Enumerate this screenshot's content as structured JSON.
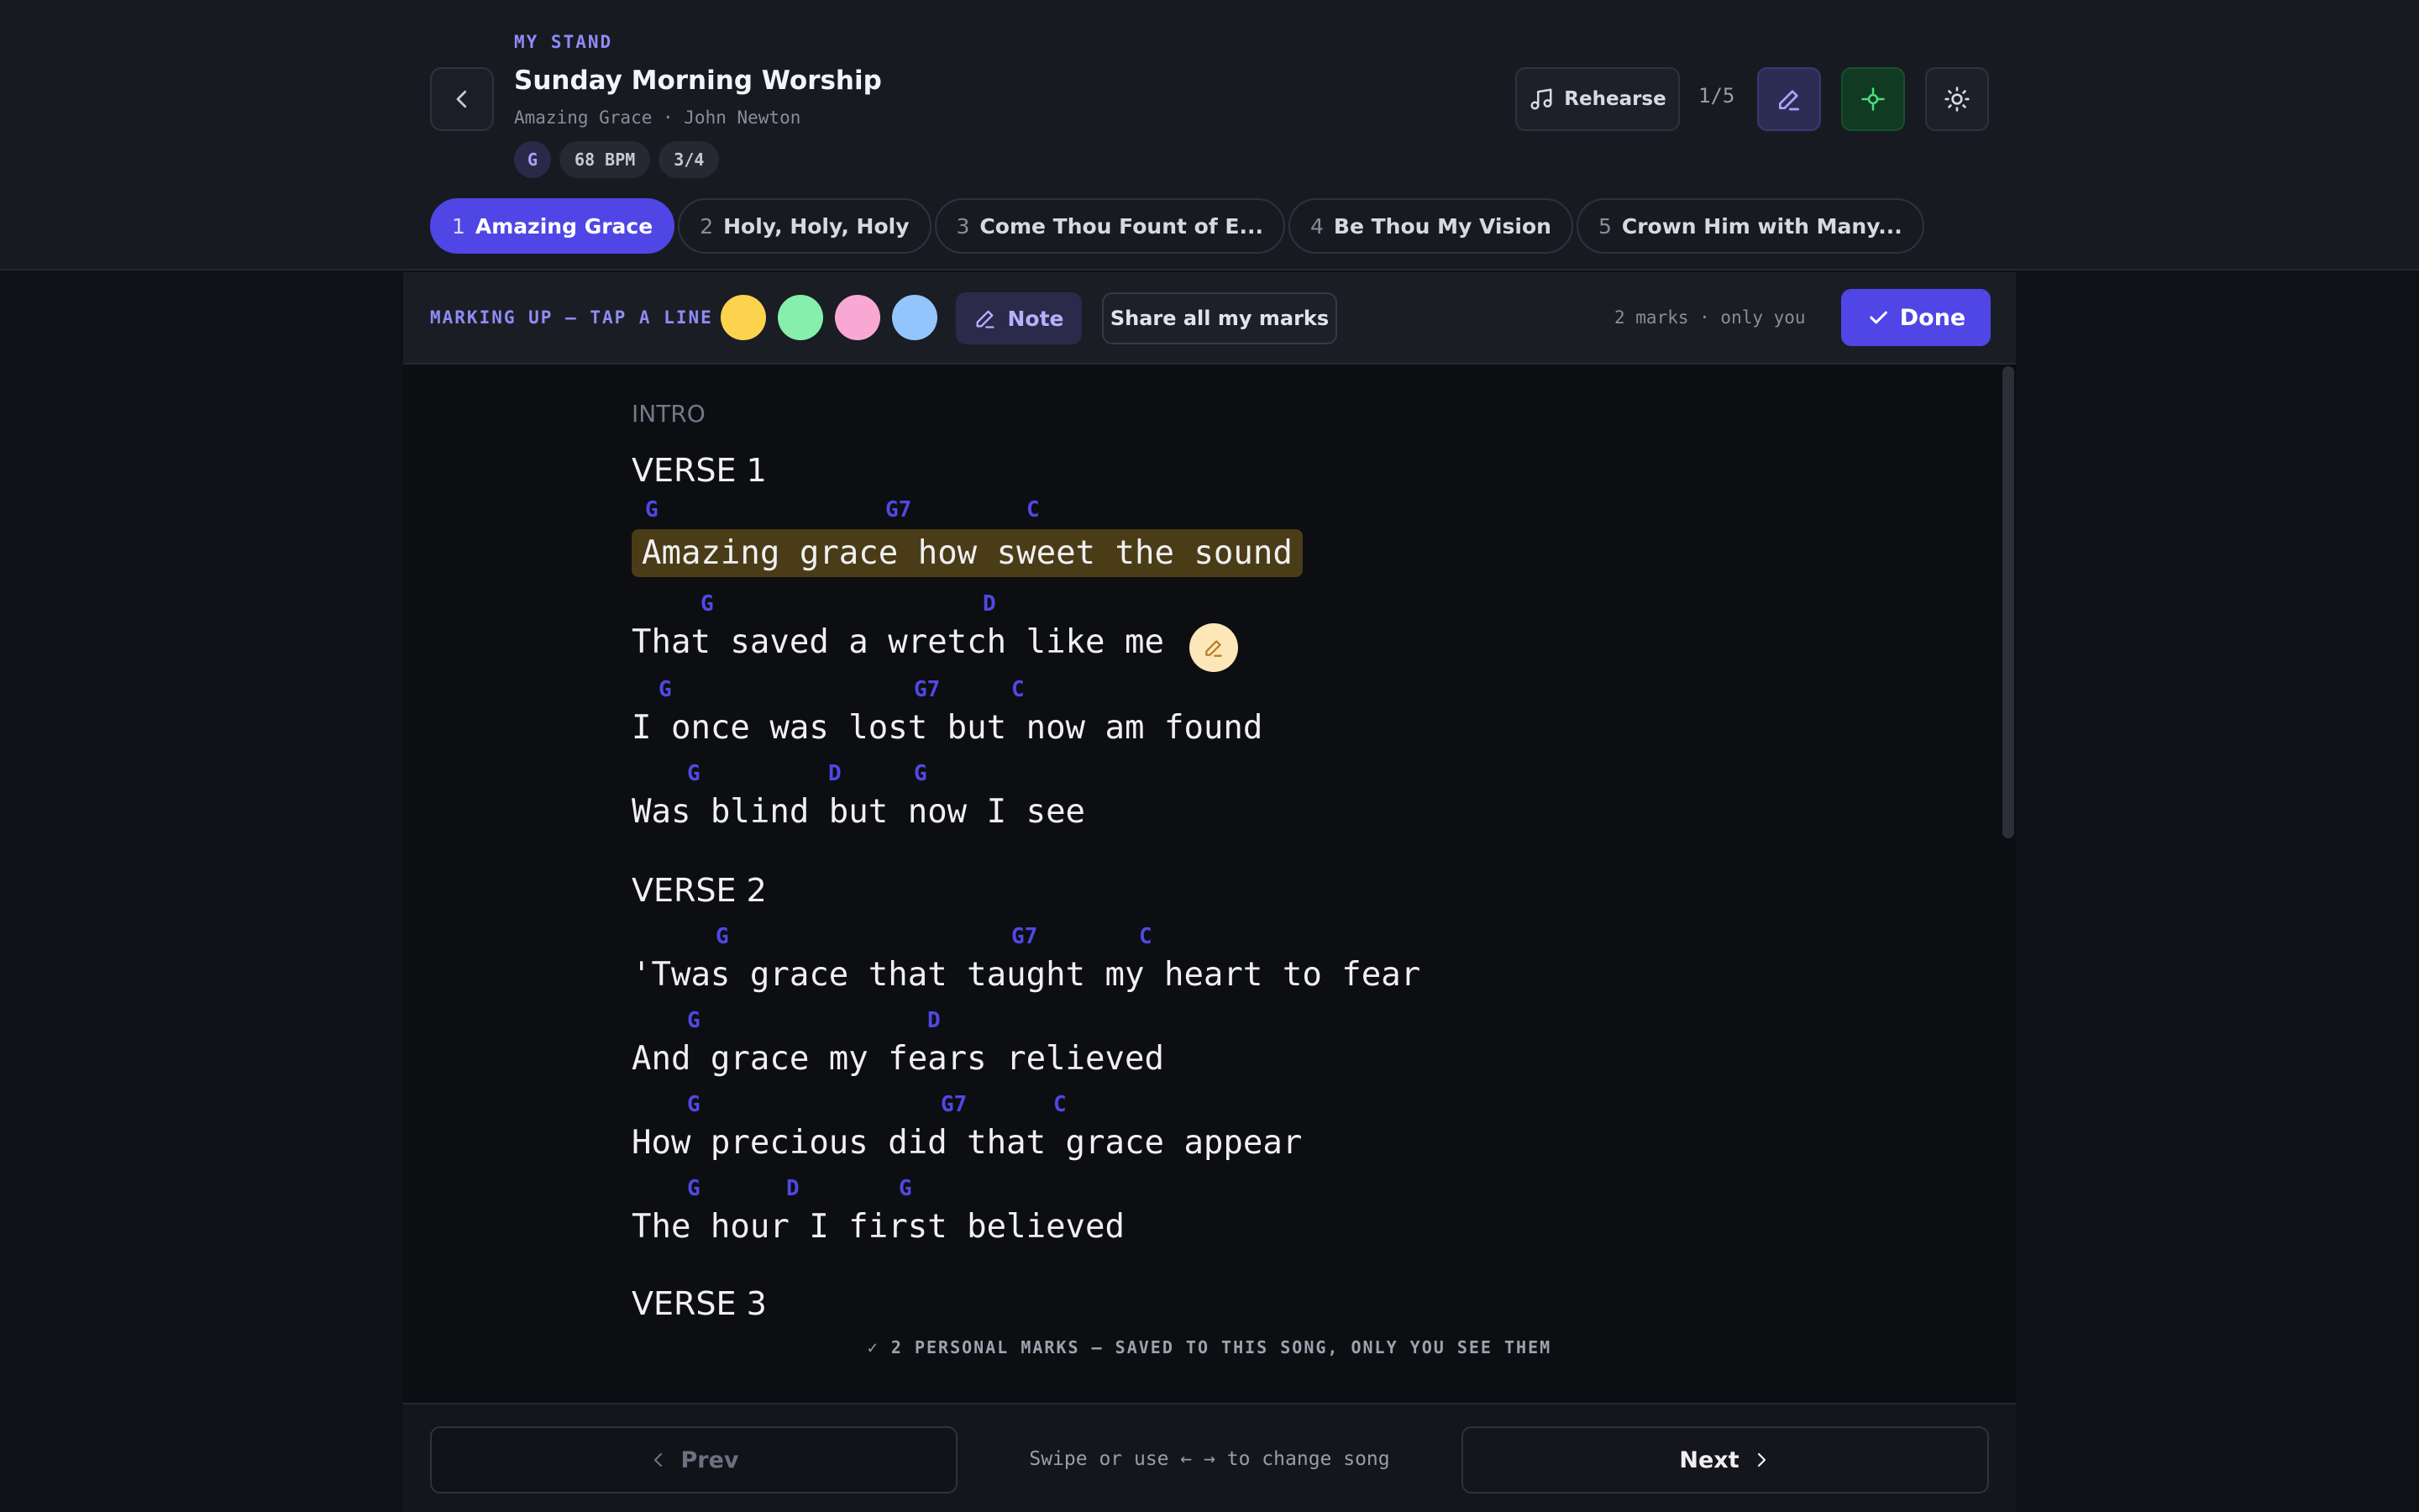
{
  "header": {
    "eyebrow": "MY STAND",
    "title": "Sunday Morning Worship",
    "song_meta": "Amazing Grace · John Newton",
    "chips": {
      "key": "G",
      "bpm": "68 BPM",
      "time": "3/4"
    },
    "rehearse_label": "Rehearse",
    "position": "1/5",
    "icons": {
      "back": "chevron-left-icon",
      "rehearse": "music-note-icon",
      "edit": "pencil-icon",
      "focus": "crosshair-icon",
      "theme": "sun-icon"
    }
  },
  "tabs": [
    {
      "num": "1",
      "label": "Amazing Grace",
      "active": true
    },
    {
      "num": "2",
      "label": "Holy, Holy, Holy"
    },
    {
      "num": "3",
      "label": "Come Thou Fount of E..."
    },
    {
      "num": "4",
      "label": "Be Thou My Vision"
    },
    {
      "num": "5",
      "label": "Crown Him with Many..."
    }
  ],
  "markup": {
    "label": "MARKING UP — TAP A LINE",
    "colors": [
      "#fcd34d",
      "#86efac",
      "#f9a8d4",
      "#93c5fd"
    ],
    "note_label": "Note",
    "share_label": "Share all my marks",
    "marks_count": "2 marks · only you",
    "done_label": "Done",
    "highlight_color": "#4a3c16"
  },
  "song": {
    "intro": "INTRO",
    "verse1": {
      "heading": "VERSE 1",
      "lines": [
        {
          "chords": [
            "G",
            "G7",
            "C"
          ],
          "text": "Amazing grace how sweet the sound"
        },
        {
          "chords": [
            "G",
            "D"
          ],
          "text": "That saved a wretch like me"
        },
        {
          "chords": [
            "G",
            "G7",
            "C"
          ],
          "text": "I once was lost but now am found"
        },
        {
          "chords": [
            "G",
            "D",
            "G"
          ],
          "text": "Was blind but now I see"
        }
      ]
    },
    "verse2": {
      "heading": "VERSE 2",
      "lines": [
        {
          "chords": [
            "G",
            "G7",
            "C"
          ],
          "text": "'Twas grace that taught my heart to fear"
        },
        {
          "chords": [
            "G",
            "D"
          ],
          "text": "And grace my fears relieved"
        },
        {
          "chords": [
            "G",
            "G7",
            "C"
          ],
          "text": "How precious did that grace appear"
        },
        {
          "chords": [
            "G",
            "D",
            "G"
          ],
          "text": "The hour I first believed"
        }
      ]
    },
    "verse3": {
      "heading": "VERSE 3"
    },
    "footer_note": "✓ 2 PERSONAL MARKS — SAVED TO THIS SONG, ONLY YOU SEE THEM"
  },
  "bottom": {
    "prev_label": "Prev",
    "hint": "Swipe or use ← → to change song",
    "next_label": "Next"
  }
}
